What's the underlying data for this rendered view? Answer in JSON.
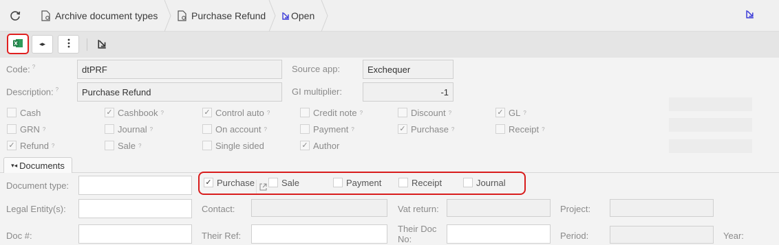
{
  "breadcrumb": {
    "items": [
      {
        "label": "Archive document types",
        "icon": "document-settings-icon"
      },
      {
        "label": "Purchase Refund",
        "icon": "document-settings-icon"
      },
      {
        "label": "Open",
        "icon": "open-arrow-icon"
      }
    ]
  },
  "toolbar": {
    "buttons": [
      "excel-export-icon",
      "expand-collapse-icon",
      "more-vertical-icon",
      "open-arrow-icon"
    ]
  },
  "form": {
    "code_label": "Code:",
    "code_value": "dtPRF",
    "source_app_label": "Source app:",
    "source_app_value": "Exchequer",
    "description_label": "Description:",
    "description_value": "Purchase Refund",
    "gl_multiplier_label": "GI multiplier:",
    "gl_multiplier_value": "-1",
    "hint": "?"
  },
  "flags": {
    "cash": "Cash",
    "cashbook": "Cashbook",
    "control_auto": "Control auto",
    "credit_note": "Credit note",
    "discount": "Discount",
    "gl": "GL",
    "grn": "GRN",
    "journal": "Journal",
    "on_account": "On account",
    "payment": "Payment",
    "purchase": "Purchase",
    "receipt": "Receipt",
    "refund": "Refund",
    "sale": "Sale",
    "single_sided": "Single sided",
    "author": "Author",
    "check": "✓"
  },
  "tabs": {
    "documents": "Documents"
  },
  "documents": {
    "document_type_label": "Document type:",
    "legal_entity_label": "Legal Entity(s):",
    "doc_no_label": "Doc #:",
    "contact_label": "Contact:",
    "their_ref_label": "Their Ref:",
    "vat_return_label": "Vat return:",
    "their_doc_no_label": "Their Doc No:",
    "project_label": "Project:",
    "period_label": "Period:",
    "year_label": "Year:",
    "filter_purchase": "Purchase",
    "filter_sale": "Sale",
    "filter_payment": "Payment",
    "filter_receipt": "Receipt",
    "filter_journal": "Journal"
  },
  "colors": {
    "highlight": "#d81b1b",
    "excel": "#1e7e45",
    "link": "#3a3ad8"
  }
}
